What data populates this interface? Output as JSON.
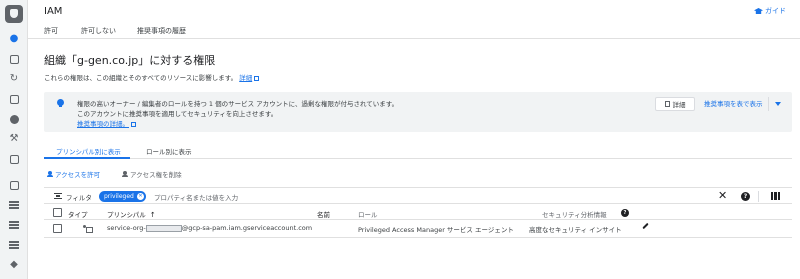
{
  "header": {
    "title": "IAM",
    "guide_label": "ガイド"
  },
  "top_tabs": [
    "許可",
    "許可しない",
    "推奨事項の履歴"
  ],
  "page": {
    "heading": "組織「g-gen.co.jp」に対する権限",
    "description": "これらの権限は、この組織とそのすべてのリソースに影響します。",
    "description_link": "詳細"
  },
  "banner": {
    "line1": "権限の高いオーナー / 編集者のロールを持つ 1 個のサービス アカウントに、過剰な権限が付与されています。",
    "line2": "このアカウントに推奨事項を適用してセキュリティを向上させます。",
    "link": "推奨事項の詳細。",
    "details_button": "詳細",
    "show_in_table_button": "推奨事項を表で表示"
  },
  "view_tabs": [
    "プリンシパル別に表示",
    "ロール別に表示"
  ],
  "actions": {
    "grant": "アクセスを許可",
    "remove": "アクセス権を削除"
  },
  "filter": {
    "label": "フィルタ",
    "chip": "privileged",
    "placeholder": "プロパティ名または値を入力"
  },
  "table": {
    "headers": [
      "タイプ",
      "プリンシパル",
      "名前",
      "ロール",
      "セキュリティ分析情報"
    ],
    "rows": [
      {
        "principal_prefix": "service-org-",
        "principal_suffix": "@gcp-sa-pam.iam.gserviceaccount.com",
        "name": "",
        "role": "Privileged Access Manager サービス エージェント",
        "insight": "高度なセキュリティ インサイト"
      }
    ]
  },
  "colors": {
    "accent": "#1a73e8",
    "banner_bg": "#f1f3f4"
  }
}
